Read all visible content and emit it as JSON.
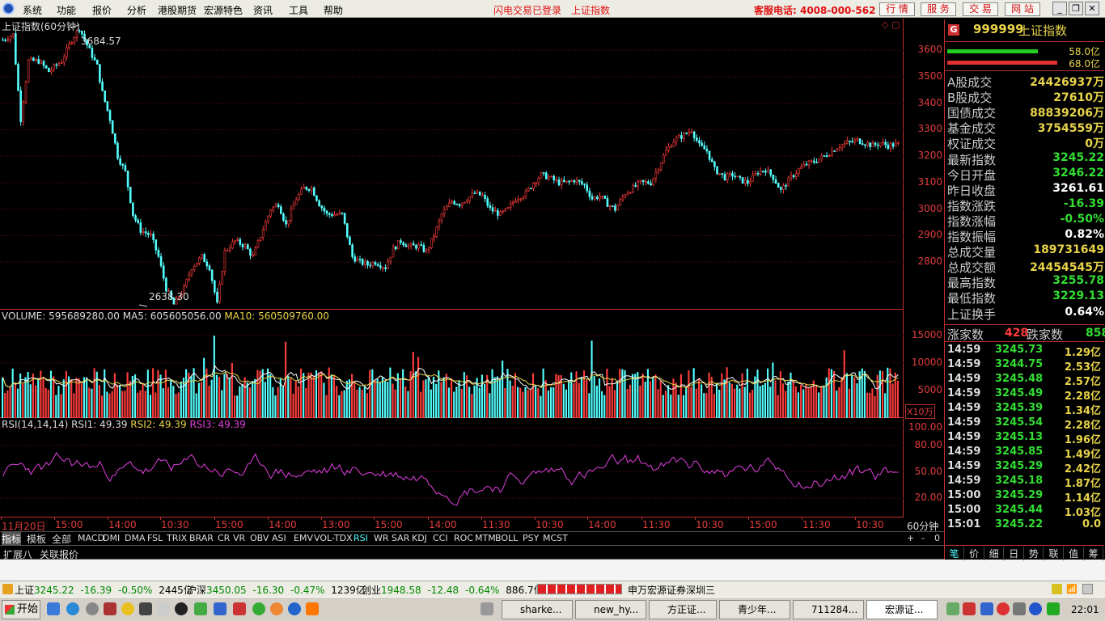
{
  "menubar": {
    "items": [
      "系统",
      "功能",
      "报价",
      "分析",
      "港股期货",
      "宏源特色",
      "资讯",
      "工具",
      "帮助"
    ],
    "status_login": "闪电交易已登录",
    "status_index": "上证指数",
    "service_phone": "客服电话: 4008-000-562",
    "right_buttons": [
      "行 情",
      "服 务",
      "交 易",
      "网 站"
    ]
  },
  "price_chart": {
    "title": "上证指数(60分钟)",
    "high_label": "3684.57",
    "low_label": "2638.30"
  },
  "volume_chart": {
    "label": "VOLUME: 595689280.00",
    "ma5": "MA5: 605605056.00",
    "ma10": "MA10: 560509760.00",
    "unit": "X10万"
  },
  "rsi_chart": {
    "label": "RSI(14,14,14)",
    "rsi1": "RSI1: 49.39",
    "rsi2": "RSI2: 49.39",
    "rsi3": "RSI3: 49.39"
  },
  "time_axis": {
    "labels": [
      "11月20日",
      "15:00",
      "14:00",
      "10:30",
      "15:00",
      "14:00",
      "13:00",
      "15:00",
      "14:00",
      "11:30",
      "10:30",
      "14:00",
      "11:30",
      "10:30",
      "15:00",
      "11:30",
      "10:30"
    ],
    "period": "60分钟"
  },
  "chart_data": [
    {
      "type": "candlestick",
      "title": "上证指数(60分钟)",
      "y_ticks": [
        3600,
        3500,
        3400,
        3300,
        3200,
        3100,
        3000,
        2900,
        2800
      ],
      "ylim": [
        2620,
        3720
      ],
      "annotations": {
        "high": 3684.57,
        "low": 2638.3
      },
      "anchors": [
        [
          0,
          3640
        ],
        [
          4,
          3660
        ],
        [
          7,
          3340
        ],
        [
          10,
          3560
        ],
        [
          14,
          3560
        ],
        [
          18,
          3520
        ],
        [
          23,
          3560
        ],
        [
          27,
          3640
        ],
        [
          30,
          3684
        ],
        [
          33,
          3620
        ],
        [
          37,
          3540
        ],
        [
          39,
          3440
        ],
        [
          42,
          3340
        ],
        [
          45,
          3200
        ],
        [
          48,
          3140
        ],
        [
          51,
          2980
        ],
        [
          54,
          2920
        ],
        [
          58,
          2900
        ],
        [
          61,
          2820
        ],
        [
          64,
          2700
        ],
        [
          67,
          2640
        ],
        [
          71,
          2700
        ],
        [
          74,
          2780
        ],
        [
          78,
          2820
        ],
        [
          81,
          2780
        ],
        [
          84,
          2640
        ],
        [
          87,
          2840
        ],
        [
          91,
          2880
        ],
        [
          95,
          2860
        ],
        [
          98,
          2820
        ],
        [
          101,
          2900
        ],
        [
          105,
          3000
        ],
        [
          108,
          3020
        ],
        [
          111,
          2940
        ],
        [
          115,
          3040
        ],
        [
          118,
          3080
        ],
        [
          121,
          3080
        ],
        [
          124,
          3020
        ],
        [
          127,
          2980
        ],
        [
          130,
          2980
        ],
        [
          133,
          2980
        ],
        [
          137,
          2820
        ],
        [
          140,
          2800
        ],
        [
          143,
          2790
        ],
        [
          146,
          2800
        ],
        [
          150,
          2780
        ],
        [
          153,
          2850
        ],
        [
          156,
          2880
        ],
        [
          159,
          2860
        ],
        [
          163,
          2860
        ],
        [
          166,
          2840
        ],
        [
          169,
          2900
        ],
        [
          172,
          2980
        ],
        [
          176,
          3030
        ],
        [
          179,
          3020
        ],
        [
          182,
          3040
        ],
        [
          185,
          3060
        ],
        [
          188,
          3050
        ],
        [
          191,
          3000
        ],
        [
          195,
          2980
        ],
        [
          198,
          3000
        ],
        [
          201,
          3040
        ],
        [
          205,
          3060
        ],
        [
          208,
          3100
        ],
        [
          211,
          3130
        ],
        [
          214,
          3120
        ],
        [
          218,
          3100
        ],
        [
          221,
          3100
        ],
        [
          224,
          3110
        ],
        [
          228,
          3090
        ],
        [
          231,
          3040
        ],
        [
          234,
          3050
        ],
        [
          237,
          3020
        ],
        [
          240,
          3000
        ],
        [
          244,
          3060
        ],
        [
          247,
          3080
        ],
        [
          250,
          3100
        ],
        [
          254,
          3100
        ],
        [
          257,
          3160
        ],
        [
          260,
          3220
        ],
        [
          263,
          3260
        ],
        [
          267,
          3280
        ],
        [
          270,
          3300
        ],
        [
          273,
          3240
        ],
        [
          276,
          3220
        ],
        [
          279,
          3150
        ],
        [
          283,
          3120
        ],
        [
          286,
          3130
        ],
        [
          289,
          3110
        ],
        [
          292,
          3100
        ],
        [
          296,
          3140
        ],
        [
          299,
          3150
        ],
        [
          302,
          3120
        ],
        [
          305,
          3070
        ],
        [
          309,
          3120
        ],
        [
          312,
          3150
        ],
        [
          315,
          3170
        ],
        [
          318,
          3180
        ],
        [
          322,
          3200
        ],
        [
          325,
          3220
        ],
        [
          328,
          3240
        ],
        [
          331,
          3250
        ],
        [
          335,
          3260
        ],
        [
          338,
          3250
        ],
        [
          341,
          3240
        ],
        [
          344,
          3250
        ],
        [
          347,
          3240
        ],
        [
          351,
          3245
        ]
      ]
    },
    {
      "type": "bar",
      "title": "VOLUME",
      "y_ticks": [
        15000,
        10000,
        5000
      ],
      "ylim": [
        0,
        17000
      ],
      "unit": "X10万",
      "volume": 595689280.0,
      "ma5": 605605056.0,
      "ma10": 560509760.0
    },
    {
      "type": "line",
      "title": "RSI(14,14,14)",
      "y_ticks": [
        100.0,
        80.0,
        50.0,
        20.0
      ],
      "ylim": [
        0,
        100
      ],
      "series": [
        {
          "name": "RSI1",
          "last": 49.39
        },
        {
          "name": "RSI2",
          "last": 49.39
        },
        {
          "name": "RSI3",
          "last": 49.39
        }
      ]
    }
  ],
  "side": {
    "code": "999999",
    "name": "上证指数",
    "bar1_label": "58.0亿",
    "bar2_label": "68.0亿",
    "rows": [
      {
        "l": "A股成交",
        "v": "24426937万",
        "c": "#e8d44a"
      },
      {
        "l": "B股成交",
        "v": "27610万",
        "c": "#e8d44a"
      },
      {
        "l": "国债成交",
        "v": "88839206万",
        "c": "#e8d44a"
      },
      {
        "l": "基金成交",
        "v": "3754559万",
        "c": "#e8d44a"
      },
      {
        "l": "权证成交",
        "v": "0万",
        "c": "#e8d44a"
      },
      {
        "l": "最新指数",
        "v": "3245.22",
        "c": "#33dd33"
      },
      {
        "l": "今日开盘",
        "v": "3246.22",
        "c": "#33dd33"
      },
      {
        "l": "昨日收盘",
        "v": "3261.61",
        "c": "#ffffff"
      },
      {
        "l": "指数涨跌",
        "v": "-16.39",
        "c": "#33dd33"
      },
      {
        "l": "指数涨幅",
        "v": "-0.50%",
        "c": "#33dd33"
      },
      {
        "l": "指数振幅",
        "v": "0.82%",
        "c": "#ffffff"
      },
      {
        "l": "总成交量",
        "v": "189731649",
        "c": "#e8d44a"
      },
      {
        "l": "总成交额",
        "v": "24454545万",
        "c": "#e8d44a"
      },
      {
        "l": "最高指数",
        "v": "3255.78",
        "c": "#33dd33"
      },
      {
        "l": "最低指数",
        "v": "3229.13",
        "c": "#33dd33"
      },
      {
        "l": "上证换手",
        "v": "0.64%",
        "c": "#ffffff"
      }
    ],
    "up_label": "涨家数",
    "up_count": "428",
    "down_label": "跌家数",
    "down_count": "858",
    "ticks": [
      {
        "t": "14:59",
        "p": "3245.73",
        "v": "1.29亿"
      },
      {
        "t": "14:59",
        "p": "3244.75",
        "v": "2.53亿"
      },
      {
        "t": "14:59",
        "p": "3245.48",
        "v": "2.57亿"
      },
      {
        "t": "14:59",
        "p": "3245.49",
        "v": "2.28亿"
      },
      {
        "t": "14:59",
        "p": "3245.39",
        "v": "1.34亿"
      },
      {
        "t": "14:59",
        "p": "3245.54",
        "v": "2.28亿"
      },
      {
        "t": "14:59",
        "p": "3245.13",
        "v": "1.96亿"
      },
      {
        "t": "14:59",
        "p": "3245.85",
        "v": "1.49亿"
      },
      {
        "t": "14:59",
        "p": "3245.29",
        "v": "2.42亿"
      },
      {
        "t": "14:59",
        "p": "3245.18",
        "v": "1.87亿"
      },
      {
        "t": "15:00",
        "p": "3245.29",
        "v": "1.14亿"
      },
      {
        "t": "15:00",
        "p": "3245.44",
        "v": "1.03亿"
      },
      {
        "t": "15:01",
        "p": "3245.22",
        "v": "0.0"
      }
    ],
    "bottom_tabs": [
      "笔",
      "价",
      "细",
      "日",
      "势",
      "联",
      "值",
      "筹"
    ]
  },
  "indicator_tabs": [
    "指标",
    "模板",
    "全部",
    "MACD",
    "DMI",
    "DMA",
    "FSL",
    "TRIX",
    "BRAR",
    "CR",
    "VR",
    "OBV",
    "ASI",
    "EMV",
    "VOL-TDX",
    "RSI",
    "WR",
    "SAR",
    "KDJ",
    "CCI",
    "ROC",
    "MTM",
    "BOLL",
    "PSY",
    "MCST"
  ],
  "zoom_controls": [
    "+",
    "-",
    "0"
  ],
  "ext_tabs": [
    "扩展八",
    "关联报价"
  ],
  "statusbar": {
    "sh_label": "上证",
    "sh_val": "3245.22",
    "sh_chg": "-16.39",
    "sh_pct": "-0.50%",
    "sh_amt": "2445亿",
    "hs_label": "沪深",
    "hs_val": "3450.05",
    "hs_chg": "-16.30",
    "hs_pct": "-0.47%",
    "hs_amt": "1239亿",
    "cy_label": "创业",
    "cy_val": "1948.58",
    "cy_chg": "-12.48",
    "cy_pct": "-0.64%",
    "cy_amt": "886.7亿",
    "broker": "申万宏源证券深圳三"
  },
  "taskbar": {
    "start": "开始",
    "windows": [
      "sharke...",
      "new_hy...",
      "方正证...",
      "青少年...",
      "711284...",
      "宏源证..."
    ],
    "clock": "22:01"
  }
}
